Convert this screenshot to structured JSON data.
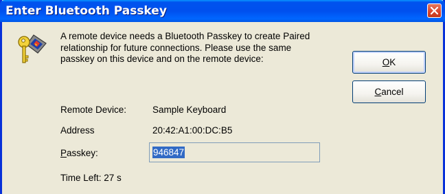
{
  "window": {
    "title": "Enter Bluetooth Passkey"
  },
  "dialog": {
    "message_lines": [
      "A remote device needs a Bluetooth Passkey to create Paired",
      "relationship for future connections. Please use the same",
      "passkey on this device and on the remote device:"
    ],
    "remote_device_label": "Remote Device:",
    "remote_device_value": "Sample Keyboard",
    "address_label": "Address",
    "address_value": "20:42:A1:00:DC:B5",
    "passkey_label": "Passkey:",
    "passkey_value": "946847",
    "time_left": "Time Left: 27 s"
  },
  "buttons": {
    "ok_label": "OK",
    "cancel_label": "Cancel"
  },
  "icons": {
    "title_close": "close-icon",
    "dialog_icon": "key-icon"
  },
  "colors": {
    "titlebar": "#0050ee",
    "window_bg": "#ece9d8",
    "close_button": "#d9432a",
    "selection": "#316ac5"
  }
}
